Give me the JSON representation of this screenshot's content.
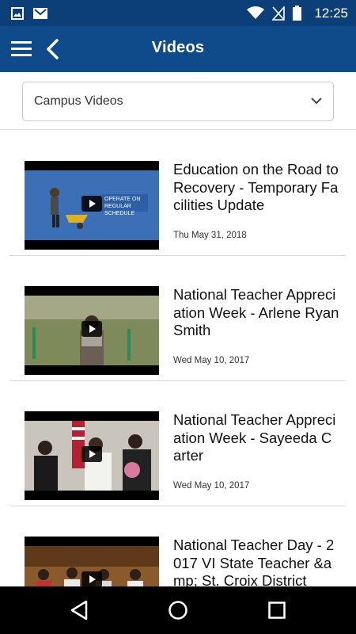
{
  "status_bar": {
    "time": "12:25",
    "icons": [
      "image-icon",
      "gmail-icon",
      "wifi-icon",
      "no-sim-icon",
      "battery-icon"
    ]
  },
  "app_bar": {
    "title": "Videos",
    "menu_icon": "hamburger-menu-icon",
    "back_icon": "back-arrow-icon"
  },
  "filter": {
    "selected": "Campus Videos",
    "icon": "chevron-down-icon"
  },
  "videos": [
    {
      "title": "Education on the Road to Recovery - Temporary Facilities Update",
      "date": "Thu May 31, 2018",
      "thumb_text": "OPERATE ON REGULAR SCHEDULE"
    },
    {
      "title": "National Teacher Appreciation Week - Arlene Ryan Smith",
      "date": "Wed May 10, 2017"
    },
    {
      "title": "National Teacher Appreciation Week - Sayeeda Carter",
      "date": "Wed May 10, 2017"
    },
    {
      "title": "National Teacher Day - 2017 VI State Teacher &amp; St. Croix District",
      "date": ""
    }
  ],
  "nav_bar": {
    "icons": [
      "back-triangle-icon",
      "home-circle-icon",
      "recents-square-icon"
    ]
  },
  "colors": {
    "status_bar": "#0c3f78",
    "app_bar": "#0f4a8a",
    "nav_bar": "#000000"
  }
}
